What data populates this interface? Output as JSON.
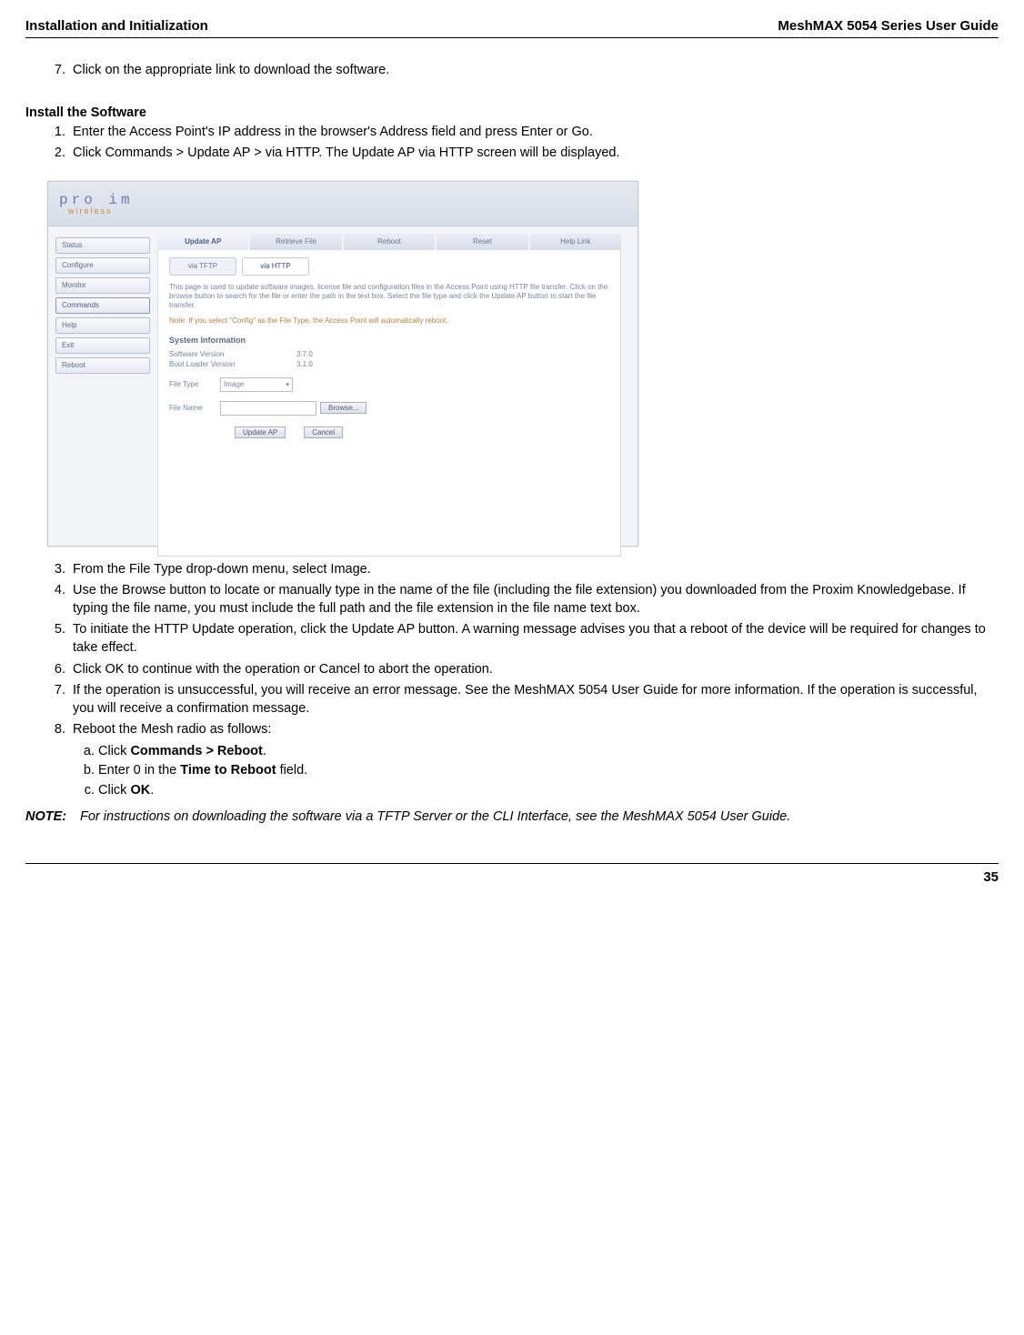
{
  "header": {
    "left": "Installation and Initialization",
    "right": "MeshMAX 5054 Series User Guide"
  },
  "footer": {
    "page": "35"
  },
  "pre_list": {
    "item7": "Click on the appropriate link to download the software."
  },
  "section": {
    "title": "Install the Software",
    "step1": "Enter the Access Point's IP address in the browser's Address field and press Enter or Go.",
    "step2": "Click Commands > Update AP > via HTTP. The Update AP via HTTP screen will be displayed.",
    "step3": "From the File Type drop-down menu, select Image.",
    "step4": "Use the Browse button to locate or manually type in the name of the file (including the file extension) you downloaded from the Proxim Knowledgebase. If typing the file name, you must include the full path and the file extension in the file name text box.",
    "step5": "To initiate the HTTP Update operation, click the Update AP button. A warning message advises you that a reboot of the device will be required for changes to take effect.",
    "step6": "Click OK to continue with the operation or Cancel to abort the operation.",
    "step7": "If the operation is unsuccessful, you will receive an error message. See the MeshMAX 5054 User Guide for more information. If the operation is successful, you will receive a confirmation message.",
    "step8": "Reboot the Mesh radio as follows:",
    "step8a_pre": "Click ",
    "step8a_b": "Commands > Reboot",
    "step8a_post": ".",
    "step8b_pre": "Enter 0 in the ",
    "step8b_b": "Time to Reboot",
    "step8b_post": " field.",
    "step8c_pre": "Click ",
    "step8c_b": "OK",
    "step8c_post": "."
  },
  "note": {
    "tag": "NOTE:",
    "body": "For instructions on downloading the software via a TFTP Server or the CLI Interface, see the MeshMAX 5054 User Guide."
  },
  "shot": {
    "logo": "pro  im",
    "logo_sub": "wireless",
    "sidebar": [
      "Status",
      "Configure",
      "Monitor",
      "Commands",
      "Help",
      "Exit",
      "Reboot"
    ],
    "sidebar_active_index": 3,
    "top_tabs": [
      "Update AP",
      "Retrieve File",
      "Reboot",
      "Reset",
      "Help Link"
    ],
    "top_sel_index": 0,
    "sub_tabs": {
      "a": "via TFTP",
      "b": "via HTTP"
    },
    "panel_text": "This page is used to update software images, license file and configuration files in the Access Point using HTTP file transfer. Click on the browse button to search for the file or enter the path in the text box. Select the file type and click the Update AP button to start the file transfer.",
    "panel_warn": "Note: If you select \"Config\" as the File Type, the Access Point will automatically reboot.",
    "sysinfo": {
      "head": "System Information",
      "row1_l": "Software Version",
      "row1_v": "3.7.0",
      "row2_l": "Boot Loader Version",
      "row2_v": "3.1.0"
    },
    "file": {
      "type_l": "File Type",
      "type_v": "Image",
      "name_l": "File Name",
      "browse": "Browse..."
    },
    "btns": {
      "update": "Update AP",
      "cancel": "Cancel"
    }
  }
}
